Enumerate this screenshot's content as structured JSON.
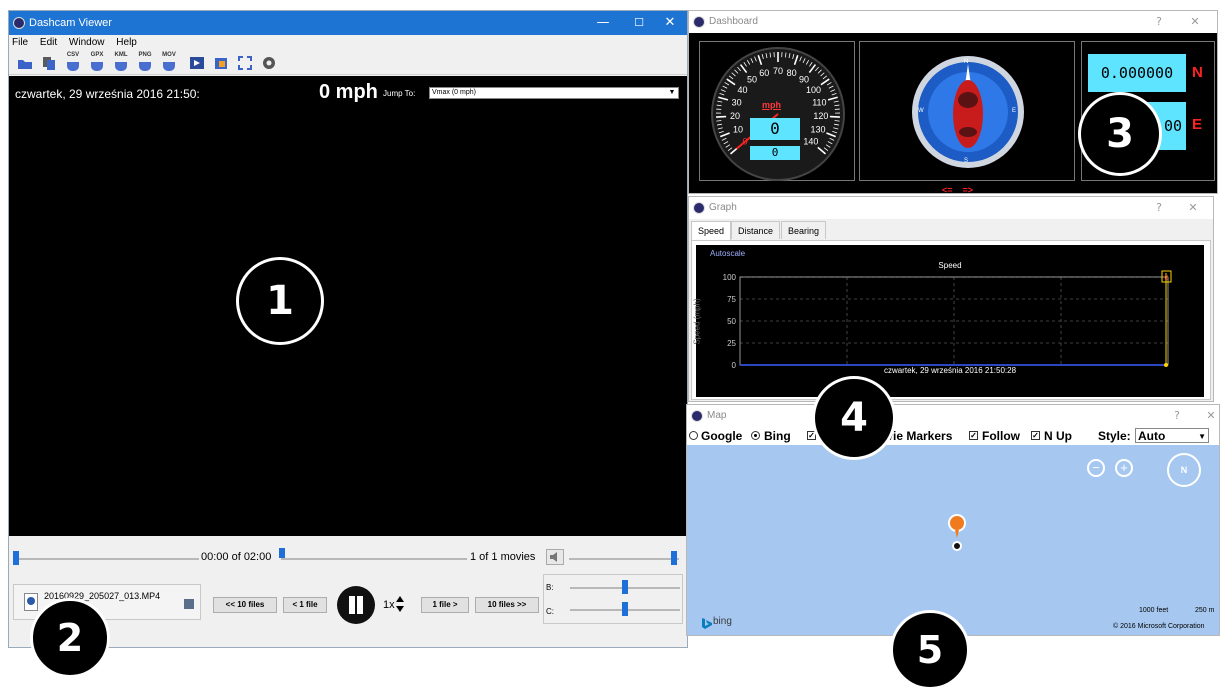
{
  "main_window": {
    "title": "Dashcam Viewer",
    "controls": {
      "minimize": "—",
      "maximize": "☐",
      "close": "✕"
    },
    "menu": [
      "File",
      "Edit",
      "Window",
      "Help"
    ],
    "toolbar": [
      {
        "icon": "open-folder-icon",
        "label": ""
      },
      {
        "icon": "files-icon",
        "label": ""
      },
      {
        "icon": "csv-export-icon",
        "label": "CSV"
      },
      {
        "icon": "gpx-export-icon",
        "label": "GPX"
      },
      {
        "icon": "kml-export-icon",
        "label": "KML"
      },
      {
        "icon": "png-export-icon",
        "label": "PNG"
      },
      {
        "icon": "mov-export-icon",
        "label": "MOV"
      },
      {
        "icon": "film-icon",
        "label": ""
      },
      {
        "icon": "lock-icon",
        "label": ""
      },
      {
        "icon": "fullscreen-icon",
        "label": ""
      },
      {
        "icon": "gear-icon",
        "label": ""
      }
    ],
    "video": {
      "date": "czwartek, 29 września 2016 21:50:",
      "speed": "0 mph",
      "jump_label": "Jump To:",
      "jump_value": "Vmax (0 mph)",
      "jump_arrow": "▼"
    },
    "controls_bar": {
      "time": "00:00 of 02:00",
      "movies": "1 of 1 movies",
      "filename": "20160929_205027_013.MP4",
      "back10": "<< 10 files",
      "back1": "< 1 file",
      "rate": "1x",
      "fwd1": "1 file >",
      "fwd10": "10 files >>",
      "b_label": "B:",
      "c_label": "C:",
      "volume_icon": "speaker-icon",
      "progress": 0.0
    }
  },
  "dashboard": {
    "title": "Dashboard",
    "help": "?",
    "close": "✕",
    "speedo_unit": "mph",
    "speedo_ticks": [
      "0",
      "10",
      "20",
      "30",
      "40",
      "50",
      "60",
      "70",
      "80",
      "90",
      "100",
      "110",
      "120",
      "130",
      "140"
    ],
    "speed_lcd": "0",
    "odo_lcd": "0",
    "compass": [
      "N",
      "E",
      "S",
      "W"
    ],
    "arrows": "<=    =>",
    "lat_lcd": "0.000000",
    "lat_dir": "N",
    "lon_lcd": "00",
    "lon_dir": "E"
  },
  "graph": {
    "title": "Graph",
    "help": "?",
    "close": "✕",
    "tabs": [
      "Speed",
      "Distance",
      "Bearing"
    ],
    "autoscale": "Autoscale",
    "marker": "0"
  },
  "chart_data": {
    "type": "line",
    "title": "Speed",
    "ylabel": "Speed (mph)",
    "xlabel": "czwartek, 29 września 2016 21:50:28",
    "yticks": [
      "0",
      "25",
      "50",
      "75",
      "100"
    ],
    "ylim": [
      0,
      100
    ],
    "series": [
      {
        "values": [
          0,
          0,
          0,
          0,
          0
        ]
      }
    ],
    "grid": true
  },
  "map": {
    "title": "Map",
    "help": "?",
    "close": "✕",
    "google": "Google",
    "bing": "Bing",
    "movie_markers": "ovie Markers",
    "follow": "Follow",
    "nup": "N Up",
    "style_label": "Style:",
    "style_value": "Auto",
    "style_arrow": "▼",
    "zoom_out": "−",
    "zoom_in": "+",
    "compass": "N",
    "bing_logo": "bing",
    "scale_feet": "1000 feet",
    "scale_m": "250 m",
    "copyright": "© 2016 Microsoft Corporation",
    "water_color": "#a6c8f0"
  },
  "callouts": [
    "1",
    "2",
    "3",
    "4",
    "5"
  ]
}
